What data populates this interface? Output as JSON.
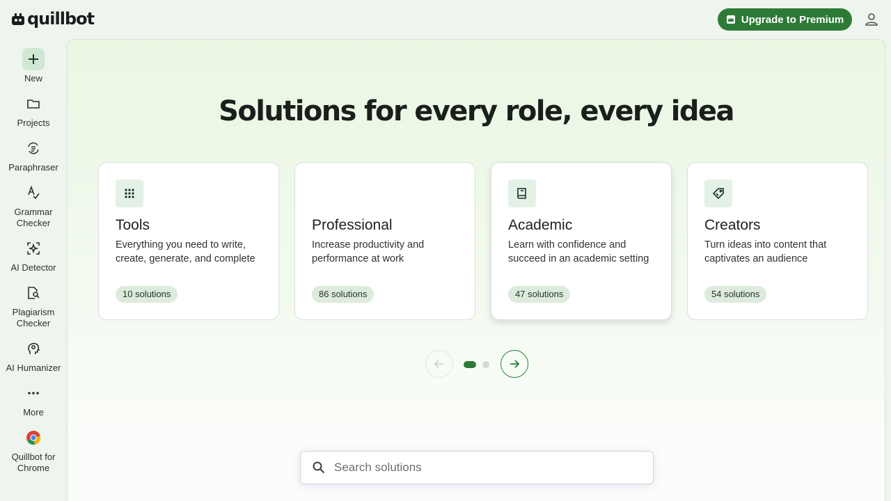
{
  "app": {
    "logo_text": "quillbot"
  },
  "header": {
    "upgrade_label": "Upgrade to Premium",
    "account_icon": "user-icon"
  },
  "sidebar": {
    "items": [
      {
        "label": "New",
        "icon": "plus-icon"
      },
      {
        "label": "Projects",
        "icon": "folder-icon"
      },
      {
        "label": "Paraphraser",
        "icon": "paraphraser-icon"
      },
      {
        "label": "Grammar Checker",
        "icon": "grammar-icon"
      },
      {
        "label": "AI Detector",
        "icon": "ai-detector-icon"
      },
      {
        "label": "Plagiarism Checker",
        "icon": "plagiarism-icon"
      },
      {
        "label": "AI Humanizer",
        "icon": "humanizer-icon"
      },
      {
        "label": "More",
        "icon": "more-dots-icon"
      },
      {
        "label": "Quillbot for Chrome",
        "icon": "chrome-icon"
      }
    ]
  },
  "main": {
    "headline": "Solutions for every role, every idea",
    "cards": [
      {
        "title": "Tools",
        "description": "Everything you need to write, create, generate, and complete",
        "badge": "10 solutions",
        "icon": "grid-icon"
      },
      {
        "title": "Professional",
        "description": "Increase productivity and performance at work",
        "badge": "86 solutions",
        "icon": ""
      },
      {
        "title": "Academic",
        "description": "Learn with confidence and succeed in an academic setting",
        "badge": "47 solutions",
        "icon": "book-icon"
      },
      {
        "title": "Creators",
        "description": "Turn ideas into content that captivates an audience",
        "badge": "54 solutions",
        "icon": "tag-icon"
      }
    ],
    "carousel": {
      "current_page": 1,
      "total_pages": 2
    },
    "search": {
      "placeholder": "Search solutions",
      "value": ""
    }
  },
  "colors": {
    "accent": "#2d7a36",
    "icon_bg": "#e3f1e6",
    "badge_bg": "#dcebdc"
  }
}
